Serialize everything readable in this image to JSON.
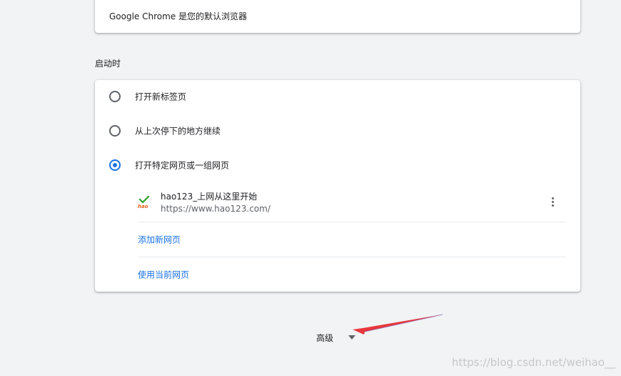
{
  "default_browser": {
    "text": "Google Chrome 是您的默认浏览器"
  },
  "startup": {
    "section_title": "启动时",
    "options": [
      {
        "label": "打开新标签页",
        "selected": false
      },
      {
        "label": "从上次停下的地方继续",
        "selected": false
      },
      {
        "label": "打开特定网页或一组网页",
        "selected": true
      }
    ],
    "pages": [
      {
        "title": "hao123_上网从这里开始",
        "url": "https://www.hao123.com/",
        "icon": "hao123-favicon"
      }
    ],
    "add_page_link": "添加新网页",
    "use_current_link": "使用当前网页"
  },
  "advanced": {
    "label": "高级",
    "icon": "caret-down-icon"
  },
  "annotation": {
    "color": "#e8383d"
  },
  "watermark": "https://blog.csdn.net/weihao__",
  "colors": {
    "accent": "#1a73e8",
    "background": "#f1f3f4",
    "card": "#ffffff"
  }
}
